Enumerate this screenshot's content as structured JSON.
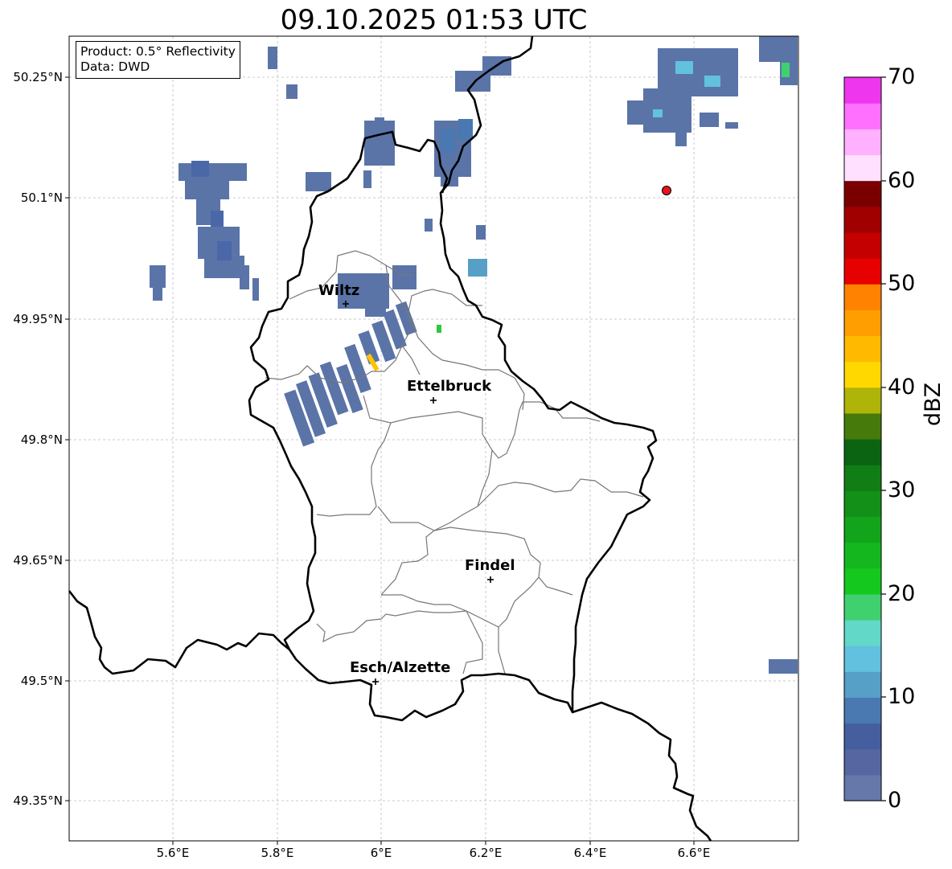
{
  "map": {
    "title": "09.10.2025 01:53 UTC",
    "product_label": "Product: 0.5° Reflectivity",
    "data_label": "Data: DWD",
    "lat_ticks": [
      "50.25°N",
      "50.1°N",
      "49.95°N",
      "49.8°N",
      "49.65°N",
      "49.5°N",
      "49.35°N"
    ],
    "lon_ticks": [
      "5.6°E",
      "5.8°E",
      "6°E",
      "6.2°E",
      "6.4°E",
      "6.6°E"
    ],
    "cities": [
      {
        "name": "Wiltz"
      },
      {
        "name": "Ettelbruck"
      },
      {
        "name": "Findel"
      },
      {
        "name": "Esch/Alzette"
      }
    ],
    "radar_site_color": "#e8141b"
  },
  "colorbar": {
    "label": "dBZ",
    "ticks": [
      "70",
      "60",
      "50",
      "40",
      "30",
      "20",
      "10",
      "0"
    ],
    "min": 0,
    "max": 70,
    "step": 2.5,
    "colors": [
      "#6677aa",
      "#5566a0",
      "#445e9e",
      "#4a78b0",
      "#569fc6",
      "#62c1de",
      "#62d8c8",
      "#40d070",
      "#14c81e",
      "#14b81e",
      "#12a41a",
      "#129018",
      "#107e14",
      "#0a6412",
      "#467a0a",
      "#aeb408",
      "#ffd800",
      "#ffba00",
      "#ff9e00",
      "#ff8200",
      "#e60000",
      "#c40000",
      "#a00000",
      "#7a0000",
      "#ffe0ff",
      "#ffb0ff",
      "#ff70ff",
      "#ee36ee"
    ]
  }
}
